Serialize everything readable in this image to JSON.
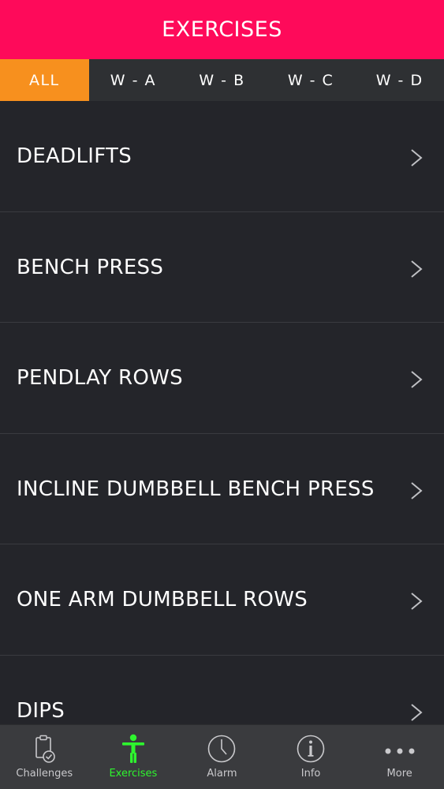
{
  "header": {
    "title": "EXERCISES"
  },
  "tabs": [
    {
      "label": "ALL",
      "active": true
    },
    {
      "label": "W - A",
      "active": false
    },
    {
      "label": "W - B",
      "active": false
    },
    {
      "label": "W - C",
      "active": false
    },
    {
      "label": "W - D",
      "active": false
    }
  ],
  "exercises": [
    {
      "label": "DEADLIFTS"
    },
    {
      "label": "BENCH PRESS"
    },
    {
      "label": "PENDLAY ROWS"
    },
    {
      "label": "INCLINE DUMBBELL BENCH PRESS"
    },
    {
      "label": "ONE ARM DUMBBELL ROWS"
    },
    {
      "label": "DIPS"
    }
  ],
  "tabbar": [
    {
      "label": "Challenges",
      "icon": "clipboard-check-icon",
      "active": false
    },
    {
      "label": "Exercises",
      "icon": "person-icon",
      "active": true
    },
    {
      "label": "Alarm",
      "icon": "clock-icon",
      "active": false
    },
    {
      "label": "Info",
      "icon": "info-icon",
      "active": false
    },
    {
      "label": "More",
      "icon": "more-dots-icon",
      "active": false
    }
  ],
  "colors": {
    "header_bg": "#fe0a5a",
    "active_tab_bg": "#f7901e",
    "tabs_bg": "#2e3033",
    "list_bg": "#24252a",
    "tabbar_bg": "#3a3b3e",
    "active_tabbar_label": "#2ef52e"
  }
}
